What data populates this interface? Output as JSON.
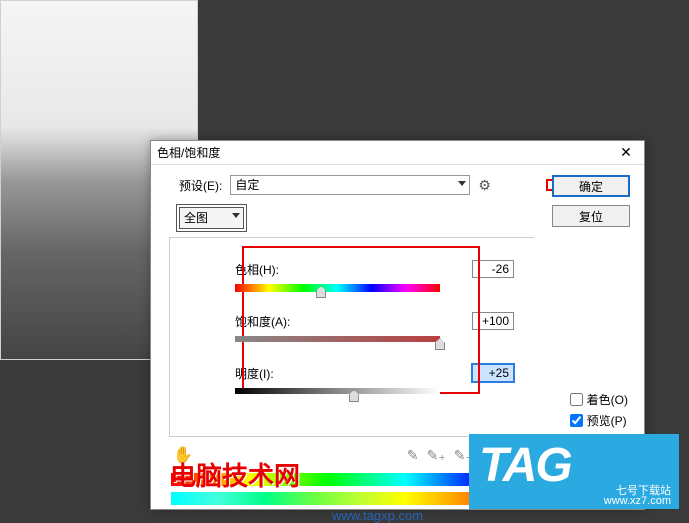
{
  "dialog": {
    "title": "色相/饱和度",
    "close": "✕",
    "preset_label": "预设(E):",
    "preset_value": "自定",
    "gear": "⚙",
    "channel_value": "全图",
    "hue_label": "色相(H):",
    "hue_value": "-26",
    "sat_label": "饱和度(A):",
    "sat_value": "+100",
    "light_label": "明度(I):",
    "light_value": "+25",
    "ok": "确定",
    "reset": "复位",
    "colorize": "着色(O)",
    "preview": "预览(P)"
  },
  "watermarks": {
    "name1": "电脑技术网",
    "tag": "TAG",
    "sub1": "七号下载站",
    "sub2": "www.xz7.com",
    "url": "www.tagxp.com"
  },
  "slider_positions": {
    "hue_pct": 42,
    "sat_pct": 100,
    "light_pct": 58
  }
}
